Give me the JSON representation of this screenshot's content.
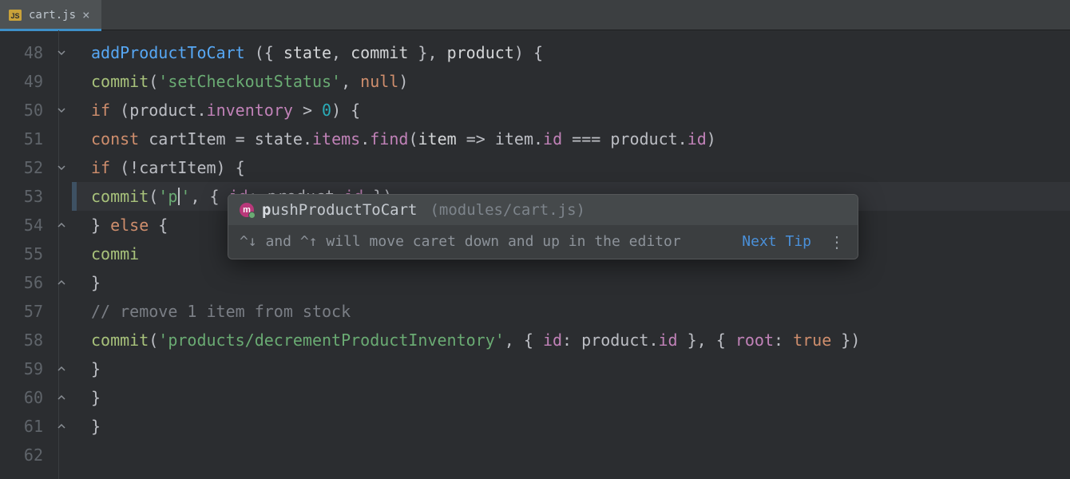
{
  "tab": {
    "file_name": "cart.js",
    "icon": "js-file-icon"
  },
  "line_numbers": [
    "48",
    "49",
    "50",
    "51",
    "52",
    "53",
    "54",
    "55",
    "56",
    "57",
    "58",
    "59",
    "60",
    "61",
    "62"
  ],
  "code": {
    "l48": {
      "fn": "addProductToCart",
      "args_open": " ({ ",
      "a1": "state",
      "sep1": ", ",
      "a2": "commit",
      "args_mid": " }, ",
      "a3": "product",
      "args_close": ") {"
    },
    "l49": {
      "call": "commit",
      "open": "(",
      "str": "'setCheckoutStatus'",
      "sep": ", ",
      "kw": "null",
      "close": ")"
    },
    "l50": {
      "kw": "if",
      "open": " (",
      "obj": "product",
      "dot": ".",
      "prop": "inventory",
      "op": " > ",
      "num": "0",
      "close": ") {"
    },
    "l51": {
      "kw": "const",
      "var": " cartItem ",
      "eq": "= ",
      "obj": "state",
      "dot1": ".",
      "prop1": "items",
      "dot2": ".",
      "method": "find",
      "open": "(",
      "p": "item",
      "arrow": " => ",
      "p2": "item",
      "dot3": ".",
      "prop2": "id",
      "opeq": " === ",
      "rhs": "product",
      "dot4": ".",
      "prop3": "id",
      "close": ")"
    },
    "l52": {
      "kw": "if",
      "open": " (!",
      "id": "cartItem",
      "close": ") {"
    },
    "l53": {
      "call": "commit",
      "open": "(",
      "str1": "'p",
      "str2": "'",
      "sep": ", { ",
      "key": "id",
      "colon": ": ",
      "obj": "product",
      "dot": ".",
      "prop": "id",
      "close": " })"
    },
    "l54": {
      "close_brace": "} ",
      "kw": "else",
      "open": " {"
    },
    "l55": {
      "call_partial": "commi"
    },
    "l56": {
      "brace": "}"
    },
    "l57": {
      "comment": "// remove 1 item from stock"
    },
    "l58": {
      "call": "commit",
      "open": "(",
      "str": "'products/decrementProductInventory'",
      "sep1": ", { ",
      "key1": "id",
      "colon1": ": ",
      "obj": "product",
      "dot": ".",
      "prop": "id",
      "mid": " }, { ",
      "key2": "root",
      "colon2": ": ",
      "val2": "true",
      "close": " })"
    },
    "l59": {
      "brace": "}"
    },
    "l60": {
      "brace": "}"
    },
    "l61": {
      "brace": "}"
    }
  },
  "completion": {
    "badge_letter": "m",
    "prefix": "p",
    "rest": "ushProductToCart",
    "path": "(modules/cart.js)",
    "tip_text": "^↓ and ^↑ will move caret down and up in the editor",
    "next_tip": "Next Tip"
  }
}
